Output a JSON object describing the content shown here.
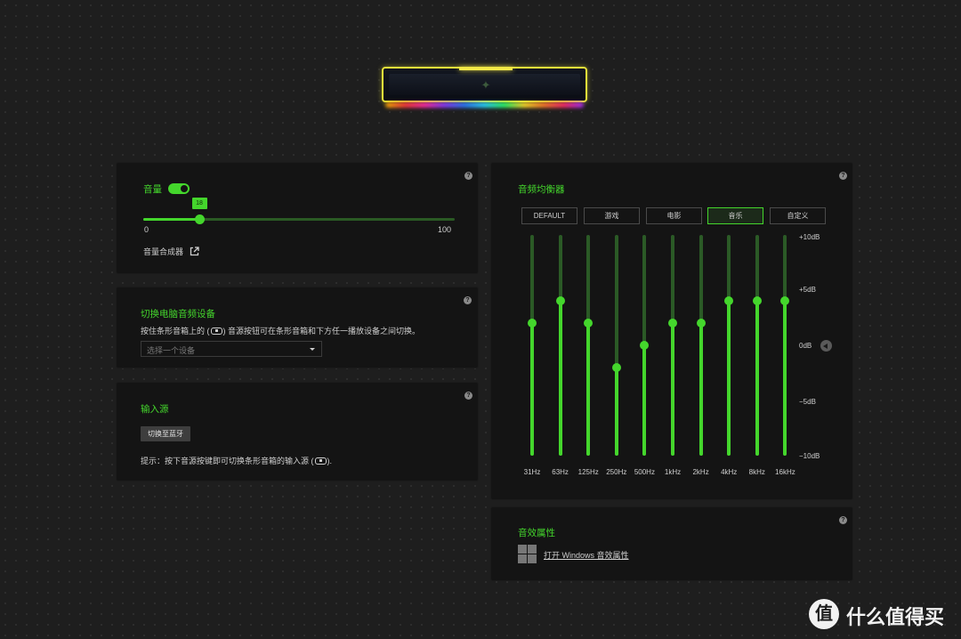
{
  "device": {
    "logo_icon": "razer-snake-icon"
  },
  "volume": {
    "title": "音量",
    "toggle_on": true,
    "value": 18,
    "value_label": "18",
    "min_label": "0",
    "max_label": "100",
    "mixer_link": "音量合成器",
    "mixer_icon": "external-link-icon",
    "help": "?"
  },
  "switch_device": {
    "title": "切换电脑音频设备",
    "desc_before": "按住条形音箱上的 (",
    "desc_after": ") 音源按钮可在条形音箱和下方任一播放设备之间切换。",
    "select_placeholder": "选择一个设备",
    "help": "?"
  },
  "input_source": {
    "title": "输入源",
    "button": "切换至蓝牙",
    "hint_before": "提示：按下音源按键即可切换条形音箱的输入源 (",
    "hint_after": ").",
    "help": "?"
  },
  "equalizer": {
    "title": "音频均衡器",
    "help": "?",
    "presets": [
      {
        "label": "DEFAULT",
        "active": false
      },
      {
        "label": "游戏",
        "active": false
      },
      {
        "label": "电影",
        "active": false
      },
      {
        "label": "音乐",
        "active": true
      },
      {
        "label": "自定义",
        "active": false
      }
    ],
    "db_labels": [
      "+10dB",
      "+5dB",
      "0dB",
      "−5dB",
      "−10dB"
    ],
    "db_range": [
      -10,
      10
    ],
    "bands": [
      {
        "label": "31Hz",
        "db": 2
      },
      {
        "label": "63Hz",
        "db": 4
      },
      {
        "label": "125Hz",
        "db": 2
      },
      {
        "label": "250Hz",
        "db": -2
      },
      {
        "label": "500Hz",
        "db": 0
      },
      {
        "label": "1kHz",
        "db": 2
      },
      {
        "label": "2kHz",
        "db": 2
      },
      {
        "label": "4kHz",
        "db": 4
      },
      {
        "label": "8kHz",
        "db": 4
      },
      {
        "label": "16kHz",
        "db": 4
      }
    ],
    "reset_icon": "reset-triangle-icon"
  },
  "sound_props": {
    "title": "音效属性",
    "link": "打开 Windows 音效属性",
    "icon": "windows-logo-icon",
    "help": "?"
  },
  "watermark": {
    "glyph": "值",
    "text": "什么值得买"
  },
  "colors": {
    "accent": "#44d62c",
    "panel": "#141414",
    "background": "#1e1e1e"
  }
}
